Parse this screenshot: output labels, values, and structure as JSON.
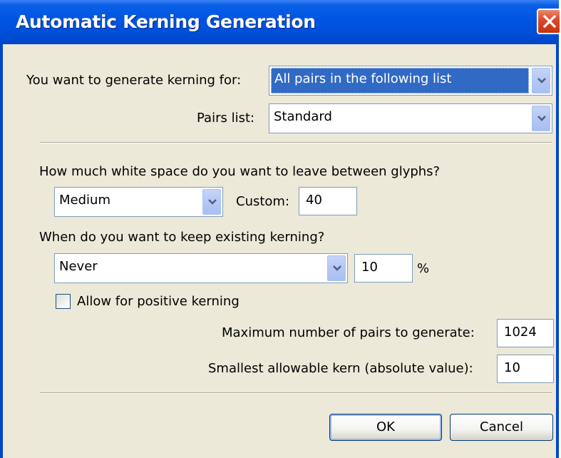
{
  "window": {
    "title": "Automatic Kerning Generation"
  },
  "generate_for": {
    "label": "You want to generate kerning for:",
    "value": "All pairs in the following list"
  },
  "pairs_list": {
    "label": "Pairs list:",
    "value": "Standard"
  },
  "white_space": {
    "question": "How much white space do you want to leave between glyphs?",
    "value": "Medium",
    "custom_label": "Custom:",
    "custom_value": "40"
  },
  "keep_existing": {
    "question": "When do you want to keep existing kerning?",
    "value": "Never",
    "percent_value": "10",
    "percent_unit": "%"
  },
  "positive_kerning": {
    "label": "Allow for positive kerning",
    "checked": false
  },
  "max_pairs": {
    "label": "Maximum number of pairs to generate:",
    "value": "1024"
  },
  "smallest_kern": {
    "label": "Smallest allowable kern (absolute value):",
    "value": "10"
  },
  "buttons": {
    "ok": "OK",
    "cancel": "Cancel"
  },
  "colors": {
    "titlebar": "#0054e3",
    "dialog_bg": "#ece9d8",
    "selection": "#316ac5",
    "close_button": "#d9482a"
  }
}
